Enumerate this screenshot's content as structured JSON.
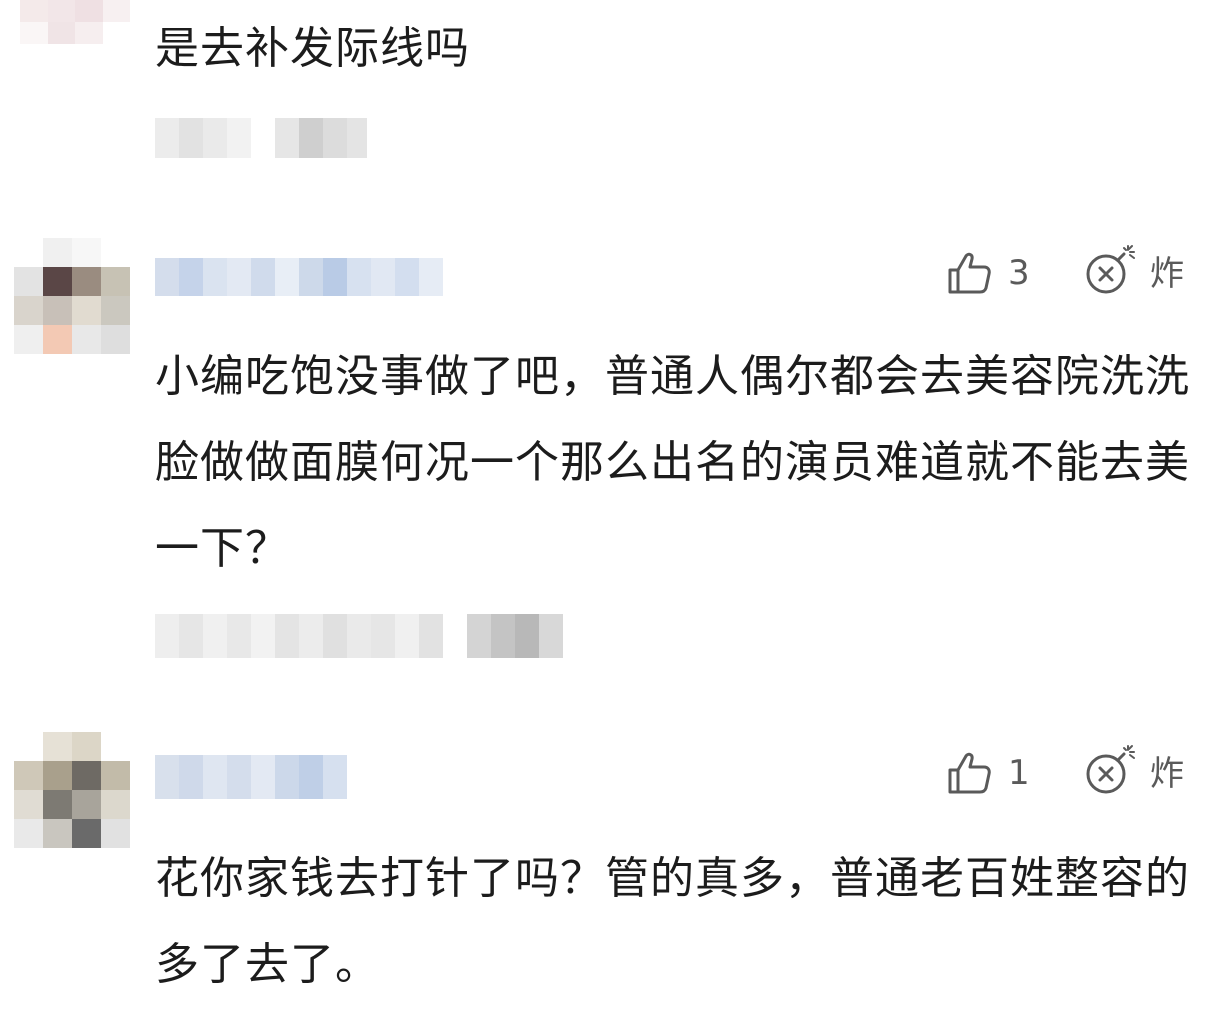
{
  "comments": [
    {
      "text": "是去补发际线吗",
      "like_count": null
    },
    {
      "text": "小编吃饱没事做了吧，普通人偶尔都会去美容院洗洗脸做做面膜何况一个那么出名的演员难道就不能去美一下？",
      "like_count": "3",
      "bomb_label": "炸"
    },
    {
      "text": "花你家钱去打针了吗？管的真多，普通老百姓整容的多了去了。",
      "like_count": "1",
      "bomb_label": "炸"
    }
  ],
  "icons": {
    "like": "thumbs-up-outline-icon",
    "bomb": "bomb-icon"
  },
  "colors": {
    "text": "#1c1c1c",
    "icon": "#5a5a5a",
    "blur_blue": "#c9d6ea",
    "blur_grey": "#d9d9d9"
  }
}
